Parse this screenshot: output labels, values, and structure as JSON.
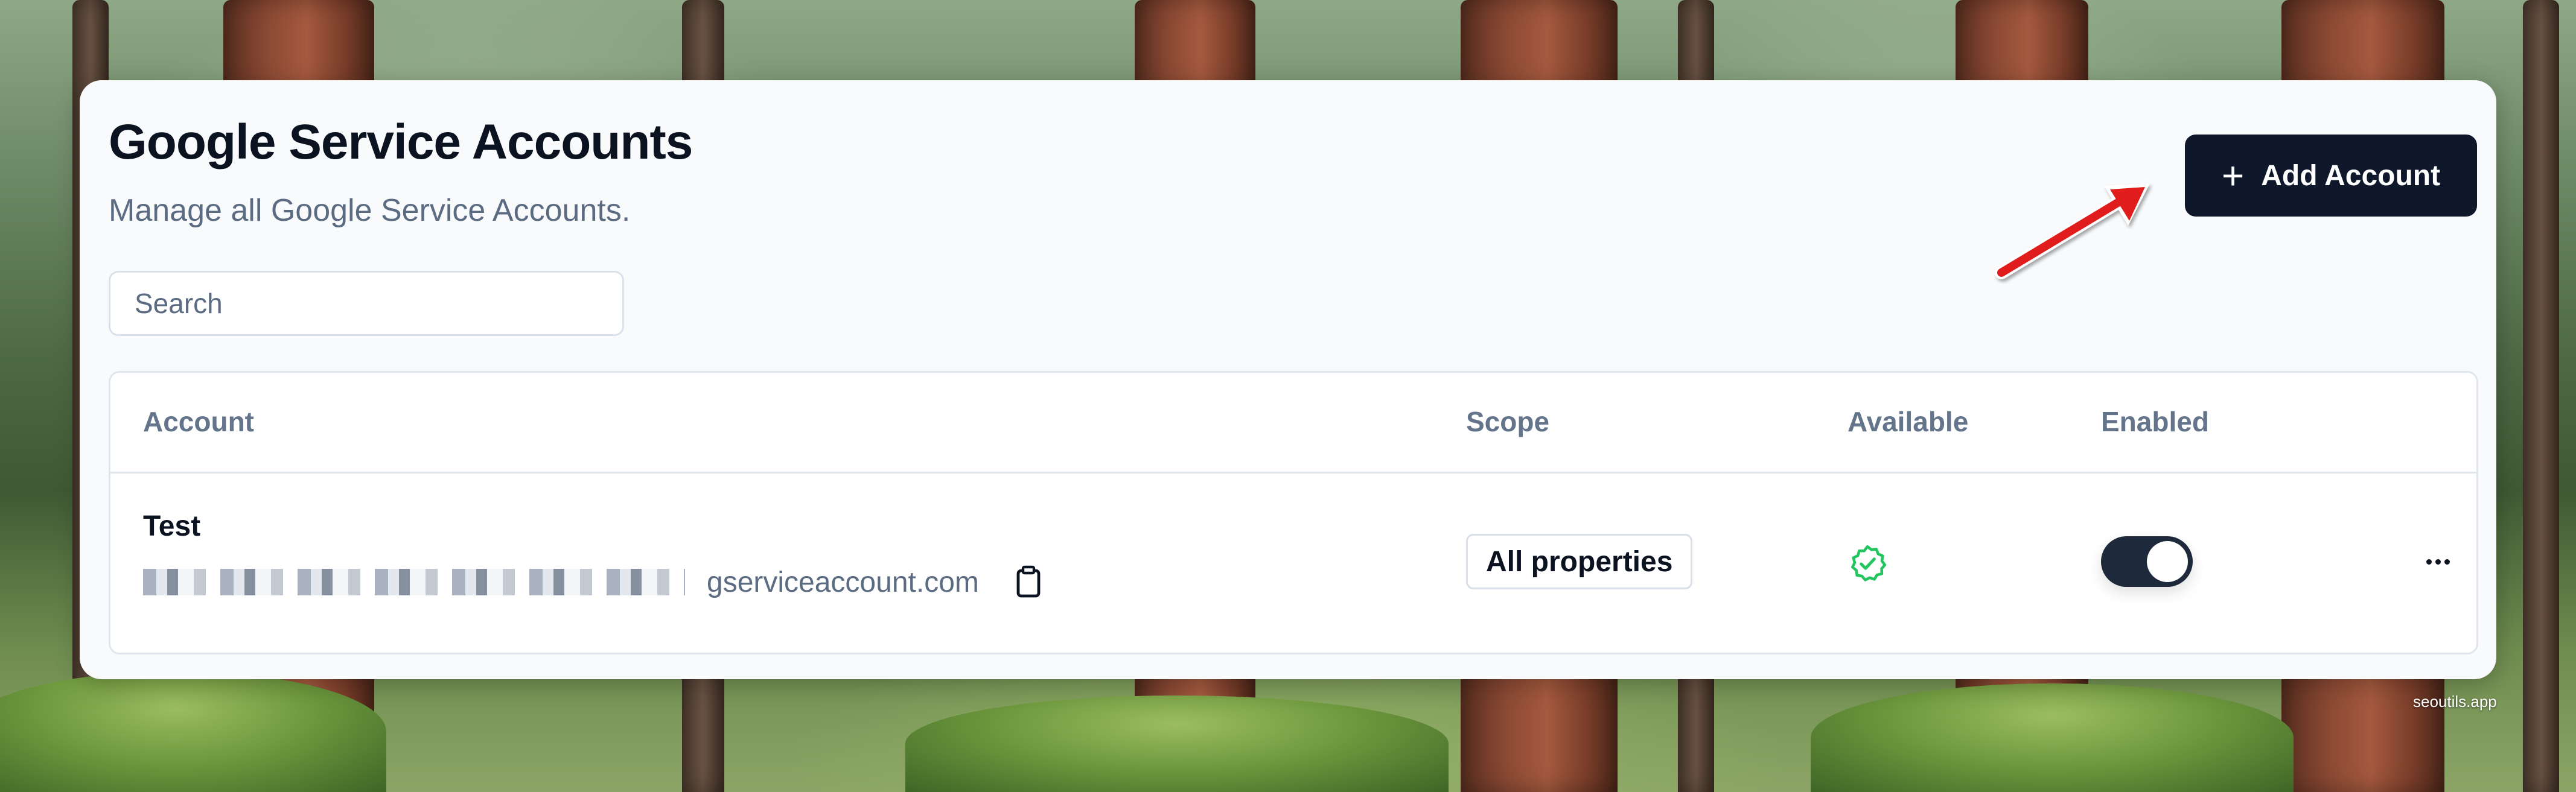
{
  "page": {
    "title": "Google Service Accounts",
    "subtitle": "Manage all Google Service Accounts."
  },
  "toolbar": {
    "add_button_label": "Add Account",
    "add_button_icon": "plus-icon"
  },
  "search": {
    "placeholder": "Search",
    "value": ""
  },
  "table": {
    "columns": [
      "Account",
      "Scope",
      "Available",
      "Enabled"
    ],
    "rows": [
      {
        "name": "Test",
        "email_domain": "gserviceaccount.com",
        "email_redacted": true,
        "scope": "All properties",
        "available": true,
        "enabled": true
      }
    ]
  },
  "icons": {
    "copy": "clipboard-icon",
    "available": "verified-badge-icon",
    "actions": "more-horizontal-icon"
  },
  "colors": {
    "primary": "#0f172a",
    "available_green": "#22c55e",
    "annotation_red": "#e11d1d",
    "muted_text": "#5b6b82"
  },
  "watermark": "seoutils.app"
}
